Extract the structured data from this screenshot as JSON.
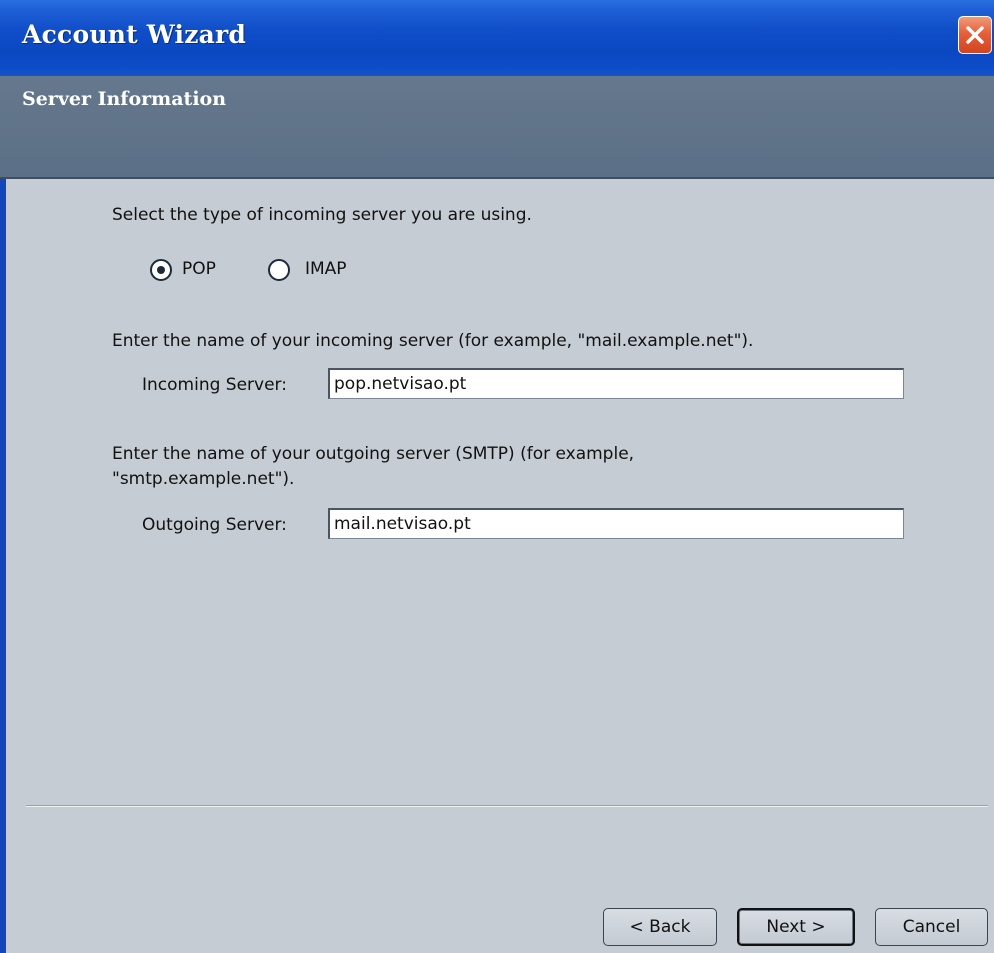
{
  "window": {
    "title": "Account Wizard"
  },
  "header": {
    "subtitle": "Server Information"
  },
  "server_type": {
    "prompt": "Select the type of incoming server you are using.",
    "options": [
      {
        "label": "POP",
        "selected": true
      },
      {
        "label": "IMAP",
        "selected": false
      }
    ]
  },
  "incoming": {
    "prompt": "Enter the name of your incoming server (for example, \"mail.example.net\").",
    "label": "Incoming Server:",
    "value": "pop.netvisao.pt"
  },
  "outgoing": {
    "prompt_line1": "Enter the name of your outgoing server (SMTP) (for example,",
    "prompt_line2": "\"smtp.example.net\").",
    "label": "Outgoing Server:",
    "value": "mail.netvisao.pt"
  },
  "buttons": {
    "back": "< Back",
    "next": "Next >",
    "cancel": "Cancel"
  },
  "colors": {
    "titlebar": "#0a48c2",
    "header_band": "#5f7389",
    "content_bg": "#c6ccd3",
    "close_button": "#e5603a"
  },
  "icons": {
    "close": "close-icon"
  }
}
